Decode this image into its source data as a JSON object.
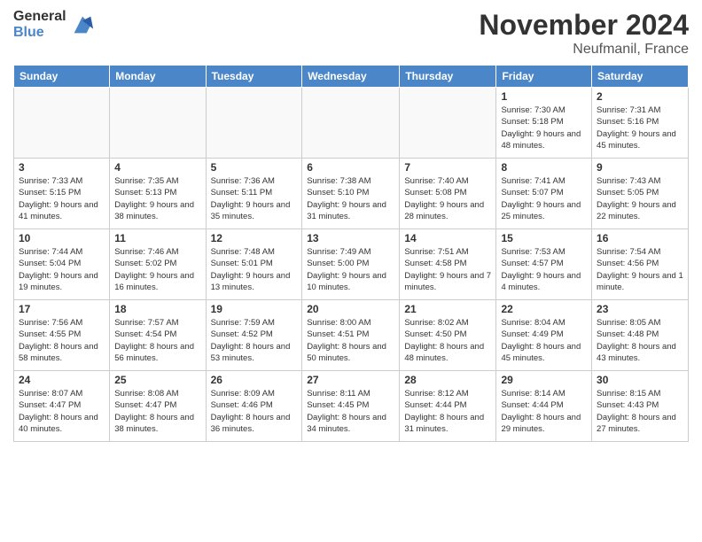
{
  "header": {
    "logo": {
      "general": "General",
      "blue": "Blue"
    },
    "title": "November 2024",
    "location": "Neufmanil, France"
  },
  "days_of_week": [
    "Sunday",
    "Monday",
    "Tuesday",
    "Wednesday",
    "Thursday",
    "Friday",
    "Saturday"
  ],
  "weeks": [
    [
      {
        "num": "",
        "empty": true
      },
      {
        "num": "",
        "empty": true
      },
      {
        "num": "",
        "empty": true
      },
      {
        "num": "",
        "empty": true
      },
      {
        "num": "",
        "empty": true
      },
      {
        "num": "1",
        "sunrise": "7:30 AM",
        "sunset": "5:18 PM",
        "daylight": "9 hours and 48 minutes."
      },
      {
        "num": "2",
        "sunrise": "7:31 AM",
        "sunset": "5:16 PM",
        "daylight": "9 hours and 45 minutes."
      }
    ],
    [
      {
        "num": "3",
        "sunrise": "7:33 AM",
        "sunset": "5:15 PM",
        "daylight": "9 hours and 41 minutes."
      },
      {
        "num": "4",
        "sunrise": "7:35 AM",
        "sunset": "5:13 PM",
        "daylight": "9 hours and 38 minutes."
      },
      {
        "num": "5",
        "sunrise": "7:36 AM",
        "sunset": "5:11 PM",
        "daylight": "9 hours and 35 minutes."
      },
      {
        "num": "6",
        "sunrise": "7:38 AM",
        "sunset": "5:10 PM",
        "daylight": "9 hours and 31 minutes."
      },
      {
        "num": "7",
        "sunrise": "7:40 AM",
        "sunset": "5:08 PM",
        "daylight": "9 hours and 28 minutes."
      },
      {
        "num": "8",
        "sunrise": "7:41 AM",
        "sunset": "5:07 PM",
        "daylight": "9 hours and 25 minutes."
      },
      {
        "num": "9",
        "sunrise": "7:43 AM",
        "sunset": "5:05 PM",
        "daylight": "9 hours and 22 minutes."
      }
    ],
    [
      {
        "num": "10",
        "sunrise": "7:44 AM",
        "sunset": "5:04 PM",
        "daylight": "9 hours and 19 minutes."
      },
      {
        "num": "11",
        "sunrise": "7:46 AM",
        "sunset": "5:02 PM",
        "daylight": "9 hours and 16 minutes."
      },
      {
        "num": "12",
        "sunrise": "7:48 AM",
        "sunset": "5:01 PM",
        "daylight": "9 hours and 13 minutes."
      },
      {
        "num": "13",
        "sunrise": "7:49 AM",
        "sunset": "5:00 PM",
        "daylight": "9 hours and 10 minutes."
      },
      {
        "num": "14",
        "sunrise": "7:51 AM",
        "sunset": "4:58 PM",
        "daylight": "9 hours and 7 minutes."
      },
      {
        "num": "15",
        "sunrise": "7:53 AM",
        "sunset": "4:57 PM",
        "daylight": "9 hours and 4 minutes."
      },
      {
        "num": "16",
        "sunrise": "7:54 AM",
        "sunset": "4:56 PM",
        "daylight": "9 hours and 1 minute."
      }
    ],
    [
      {
        "num": "17",
        "sunrise": "7:56 AM",
        "sunset": "4:55 PM",
        "daylight": "8 hours and 58 minutes."
      },
      {
        "num": "18",
        "sunrise": "7:57 AM",
        "sunset": "4:54 PM",
        "daylight": "8 hours and 56 minutes."
      },
      {
        "num": "19",
        "sunrise": "7:59 AM",
        "sunset": "4:52 PM",
        "daylight": "8 hours and 53 minutes."
      },
      {
        "num": "20",
        "sunrise": "8:00 AM",
        "sunset": "4:51 PM",
        "daylight": "8 hours and 50 minutes."
      },
      {
        "num": "21",
        "sunrise": "8:02 AM",
        "sunset": "4:50 PM",
        "daylight": "8 hours and 48 minutes."
      },
      {
        "num": "22",
        "sunrise": "8:04 AM",
        "sunset": "4:49 PM",
        "daylight": "8 hours and 45 minutes."
      },
      {
        "num": "23",
        "sunrise": "8:05 AM",
        "sunset": "4:48 PM",
        "daylight": "8 hours and 43 minutes."
      }
    ],
    [
      {
        "num": "24",
        "sunrise": "8:07 AM",
        "sunset": "4:47 PM",
        "daylight": "8 hours and 40 minutes."
      },
      {
        "num": "25",
        "sunrise": "8:08 AM",
        "sunset": "4:47 PM",
        "daylight": "8 hours and 38 minutes."
      },
      {
        "num": "26",
        "sunrise": "8:09 AM",
        "sunset": "4:46 PM",
        "daylight": "8 hours and 36 minutes."
      },
      {
        "num": "27",
        "sunrise": "8:11 AM",
        "sunset": "4:45 PM",
        "daylight": "8 hours and 34 minutes."
      },
      {
        "num": "28",
        "sunrise": "8:12 AM",
        "sunset": "4:44 PM",
        "daylight": "8 hours and 31 minutes."
      },
      {
        "num": "29",
        "sunrise": "8:14 AM",
        "sunset": "4:44 PM",
        "daylight": "8 hours and 29 minutes."
      },
      {
        "num": "30",
        "sunrise": "8:15 AM",
        "sunset": "4:43 PM",
        "daylight": "8 hours and 27 minutes."
      }
    ]
  ]
}
